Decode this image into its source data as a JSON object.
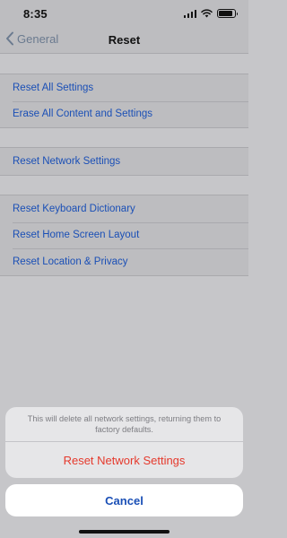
{
  "status_bar": {
    "time": "8:35",
    "battery_level": 0.9
  },
  "nav": {
    "back_label": "General",
    "title": "Reset"
  },
  "groups": [
    {
      "items": [
        "Reset All Settings",
        "Erase All Content and Settings"
      ]
    },
    {
      "items": [
        "Reset Network Settings"
      ]
    },
    {
      "items": [
        "Reset Keyboard Dictionary",
        "Reset Home Screen Layout",
        "Reset Location & Privacy"
      ]
    }
  ],
  "action_sheet": {
    "message": "This will delete all network settings, returning them to factory defaults.",
    "destructive_label": "Reset Network Settings",
    "cancel_label": "Cancel"
  },
  "colors": {
    "accent": "#1a4fb6",
    "destructive": "#e5392c"
  },
  "icons": [
    "cellular-signal-icon",
    "wifi-icon",
    "battery-icon",
    "chevron-left-icon"
  ]
}
